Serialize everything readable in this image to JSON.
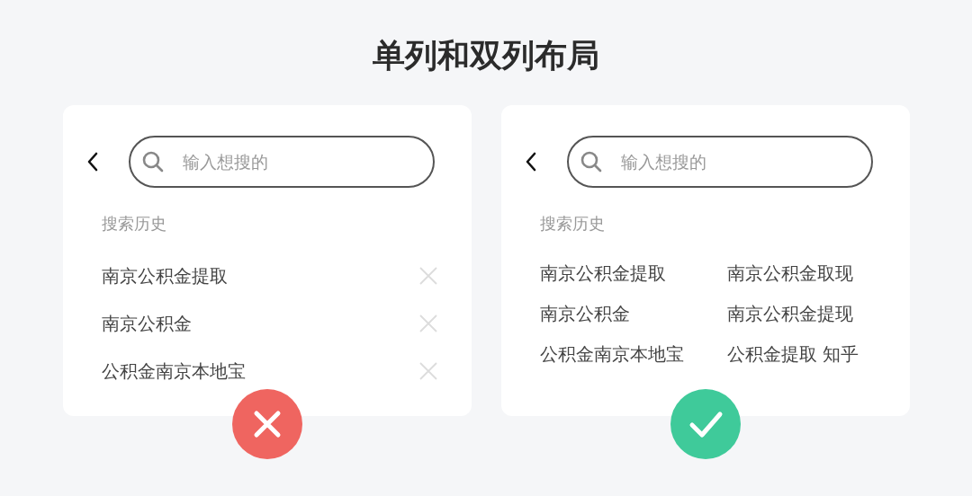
{
  "title": "单列和双列布局",
  "cards": [
    {
      "kind": "single",
      "correct": false,
      "search": {
        "placeholder": "输入想搜的"
      },
      "history_label": "搜索历史",
      "items": [
        {
          "text": "南京公积金提取"
        },
        {
          "text": "南京公积金"
        },
        {
          "text": "公积金南京本地宝"
        }
      ]
    },
    {
      "kind": "double",
      "correct": true,
      "search": {
        "placeholder": "输入想搜的"
      },
      "history_label": "搜索历史",
      "items": [
        {
          "text": "南京公积金提取"
        },
        {
          "text": "南京公积金取现"
        },
        {
          "text": "南京公积金"
        },
        {
          "text": "南京公积金提现"
        },
        {
          "text": "公积金南京本地宝"
        },
        {
          "text": "公积金提取 知乎"
        }
      ]
    }
  ]
}
